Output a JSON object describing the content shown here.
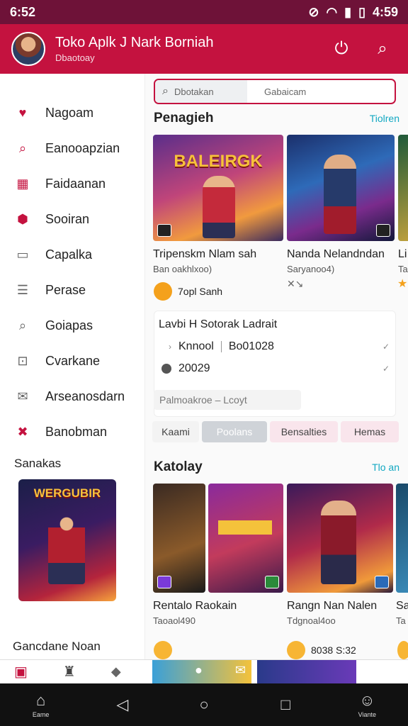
{
  "status": {
    "time": "6:52",
    "clock": "4:59",
    "icons": [
      "mute-icon",
      "wifi-icon",
      "signal-icon",
      "battery-icon"
    ]
  },
  "header": {
    "title": "Toko Aplk J Nark Borniah",
    "subtitle": "Dbaotoay",
    "accent": "#c4123f"
  },
  "sidebar": {
    "items": [
      {
        "label": "Nagoam",
        "icon": "heart-icon"
      },
      {
        "label": "Eanooapzian",
        "icon": "search-icon"
      },
      {
        "label": "Faidaanan",
        "icon": "grid-icon"
      },
      {
        "label": "Sooiran",
        "icon": "shield-icon"
      },
      {
        "label": "Capalka",
        "icon": "document-icon"
      },
      {
        "label": "Perase",
        "icon": "list-icon"
      },
      {
        "label": "Goiapas",
        "icon": "search-icon"
      },
      {
        "label": "Cvarkane",
        "icon": "bag-icon"
      },
      {
        "label": "Arseanosdarn",
        "icon": "mail-icon"
      },
      {
        "label": "Banobman",
        "icon": "close-icon"
      }
    ],
    "section_label": "Sanakas",
    "poster_title": "WERGUBIR",
    "bottom_label": "Gancdane Noan"
  },
  "search": {
    "left_text": "Dbotakan",
    "right_text": "Gabaicam"
  },
  "section1": {
    "title": "Penagieh",
    "link": "Tiolren"
  },
  "featured": [
    {
      "title": "Tripenskm Nlam sah",
      "sub": "Ban oakhlxoo)",
      "rating": "7opl Sanh",
      "art": "BALEIRGK"
    },
    {
      "title": "Nanda Nelandndan",
      "sub": "Saryanoo4)",
      "rating": ""
    },
    {
      "title": "Li",
      "sub": "Ta",
      "rating": ""
    }
  ],
  "panel": {
    "title": "Lavbi H Sotorak Ladrait",
    "rows": [
      {
        "label": "Knnool",
        "value": "Bo01028"
      },
      {
        "label": "",
        "value": "20029"
      }
    ],
    "input_placeholder": "Palmoakroe – Lcoyt"
  },
  "chips": [
    "Kaami",
    "Poolans",
    "Bensalties",
    "Hemas"
  ],
  "section2": {
    "title": "Katolay",
    "link": "Tlo an"
  },
  "catalog": [
    {
      "title": "Rentalo Raokain",
      "sub": "Taoaol490",
      "extra": ""
    },
    {
      "title": "Rangn Nan Nalen",
      "sub": "Tdgnoal4oo",
      "extra": "8038 S:32"
    },
    {
      "title": "Sa",
      "sub": "Ta",
      "extra": ""
    }
  ],
  "bottom_nav": {
    "home": "Eame",
    "profile": "Viante"
  }
}
